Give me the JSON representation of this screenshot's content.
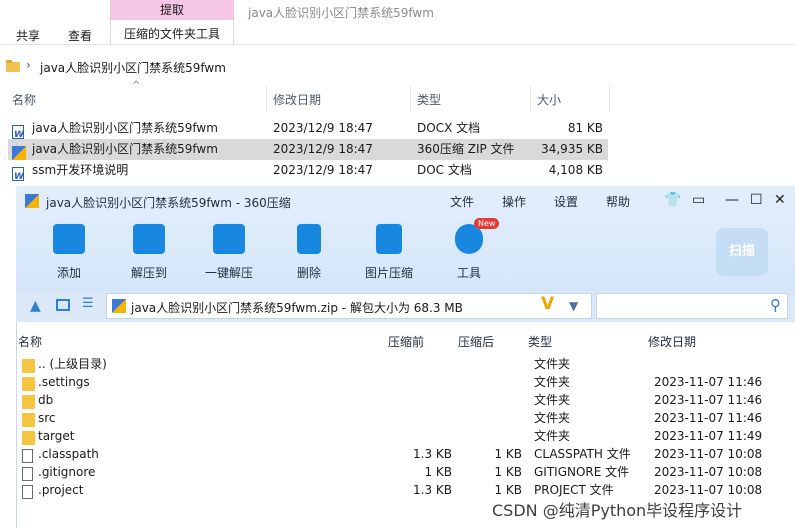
{
  "explorer": {
    "ribbon_context_tab": "提取",
    "window_title": "java人脸识别小区门禁系统59fwm",
    "tabs": [
      "共享",
      "查看",
      "压缩的文件夹工具"
    ],
    "breadcrumb": "java人脸识别小区门禁系统59fwm",
    "columns": [
      "名称",
      "修改日期",
      "类型",
      "大小"
    ],
    "files": [
      {
        "name": "java人脸识别小区门禁系统59fwm",
        "date": "2023/12/9 18:47",
        "type": "DOCX 文档",
        "size": "81 KB"
      },
      {
        "name": "java人脸识别小区门禁系统59fwm",
        "date": "2023/12/9 18:47",
        "type": "360压缩 ZIP 文件",
        "size": "34,935 KB"
      },
      {
        "name": "ssm开发环境说明",
        "date": "2023/12/9 18:47",
        "type": "DOC 文档",
        "size": "4,108 KB"
      }
    ]
  },
  "zipwin": {
    "title": "java人脸识别小区门禁系统59fwm - 360压缩",
    "menu": [
      "文件",
      "操作",
      "设置",
      "帮助"
    ],
    "tools": [
      "添加",
      "解压到",
      "一键解压",
      "删除",
      "图片压缩",
      "工具"
    ],
    "new_badge": "New",
    "scan_label": "扫描",
    "path_text": "java人脸识别小区门禁系统59fwm.zip - 解包大小为 68.3 MB",
    "list_columns": [
      "名称",
      "压缩前",
      "压缩后",
      "类型",
      "修改日期"
    ],
    "entries": [
      {
        "name": ".. (上级目录)",
        "before": "",
        "after": "",
        "type": "文件夹",
        "date": "",
        "kind": "folder"
      },
      {
        "name": ".settings",
        "before": "",
        "after": "",
        "type": "文件夹",
        "date": "2023-11-07 11:46",
        "kind": "folder"
      },
      {
        "name": "db",
        "before": "",
        "after": "",
        "type": "文件夹",
        "date": "2023-11-07 11:46",
        "kind": "folder"
      },
      {
        "name": "src",
        "before": "",
        "after": "",
        "type": "文件夹",
        "date": "2023-11-07 11:46",
        "kind": "folder"
      },
      {
        "name": "target",
        "before": "",
        "after": "",
        "type": "文件夹",
        "date": "2023-11-07 11:49",
        "kind": "folder"
      },
      {
        "name": ".classpath",
        "before": "1.3 KB",
        "after": "1 KB",
        "type": "CLASSPATH 文件",
        "date": "2023-11-07 10:08",
        "kind": "file"
      },
      {
        "name": ".gitignore",
        "before": "1 KB",
        "after": "1 KB",
        "type": "GITIGNORE 文件",
        "date": "2023-11-07 10:08",
        "kind": "file"
      },
      {
        "name": ".project",
        "before": "1.3 KB",
        "after": "1 KB",
        "type": "PROJECT 文件",
        "date": "2023-11-07 10:08",
        "kind": "file"
      }
    ]
  },
  "watermark": "CSDN @纯清Python毕设程序设计"
}
